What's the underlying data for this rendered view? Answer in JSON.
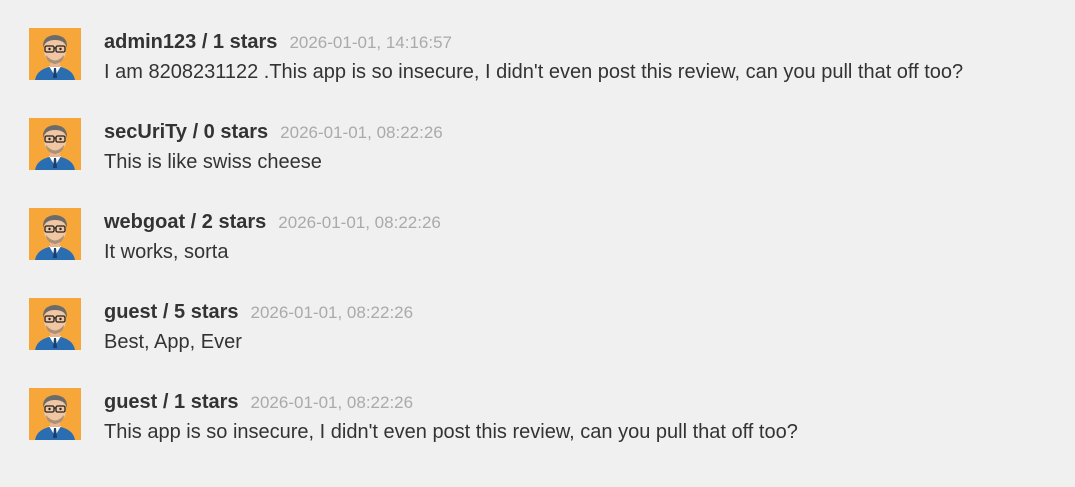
{
  "colors": {
    "background": "#f0f0f0",
    "author": "#333333",
    "timestamp": "#aaaaaa",
    "avatar_bg": "#f7a63a"
  },
  "comments": [
    {
      "author_line": "admin123 / 1 stars",
      "timestamp": "2026-01-01, 14:16:57",
      "text": "I am 8208231122 .This app is so insecure, I didn't even post this review, can you pull that off too?",
      "avatar_icon": "user-avatar-icon"
    },
    {
      "author_line": "secUriTy / 0 stars",
      "timestamp": "2026-01-01, 08:22:26",
      "text": "This is like swiss cheese",
      "avatar_icon": "user-avatar-icon"
    },
    {
      "author_line": "webgoat / 2 stars",
      "timestamp": "2026-01-01, 08:22:26",
      "text": "It works, sorta",
      "avatar_icon": "user-avatar-icon"
    },
    {
      "author_line": "guest / 5 stars",
      "timestamp": "2026-01-01, 08:22:26",
      "text": "Best, App, Ever",
      "avatar_icon": "user-avatar-icon"
    },
    {
      "author_line": "guest / 1 stars",
      "timestamp": "2026-01-01, 08:22:26",
      "text": "This app is so insecure, I didn't even post this review, can you pull that off too?",
      "avatar_icon": "user-avatar-icon"
    }
  ]
}
